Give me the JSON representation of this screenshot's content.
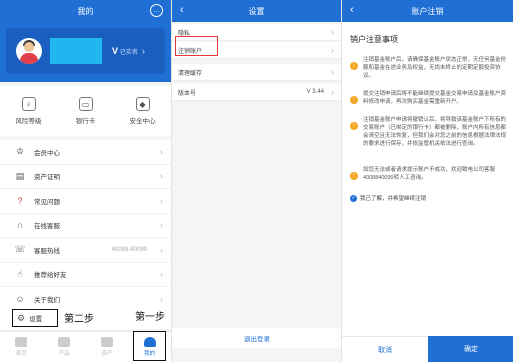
{
  "panel1": {
    "title": "我的",
    "verify_text": "已实名",
    "tools": [
      {
        "label": "风险等级",
        "icon": "risk-level-icon"
      },
      {
        "label": "银行卡",
        "icon": "bank-card-icon"
      },
      {
        "label": "安全中心",
        "icon": "security-center-icon"
      }
    ],
    "menu": [
      {
        "label": "会员中心",
        "icon": "crown-icon",
        "value": ""
      },
      {
        "label": "资产证明",
        "icon": "certificate-icon",
        "value": ""
      },
      {
        "label": "常见问题",
        "icon": "question-icon",
        "value": ""
      },
      {
        "label": "在线客服",
        "icon": "headset-icon",
        "value": ""
      },
      {
        "label": "客服热线",
        "icon": "phone-icon",
        "value": "40088-40099"
      },
      {
        "label": "推荐给好友",
        "icon": "thumbs-up-icon",
        "value": ""
      },
      {
        "label": "关于我们",
        "icon": "smile-icon",
        "value": ""
      }
    ],
    "settings_label": "设置",
    "step2": "第二步",
    "step1": "第一步",
    "tabs": [
      {
        "label": "首页"
      },
      {
        "label": "产品"
      },
      {
        "label": "资产"
      },
      {
        "label": "我的"
      }
    ]
  },
  "panel2": {
    "title": "设置",
    "rows": [
      {
        "label": "隐私",
        "value": ""
      },
      {
        "label": "注销账户",
        "value": ""
      },
      {
        "label": "清理缓存",
        "value": ""
      },
      {
        "label": "版本号",
        "value": "V 3.44"
      }
    ],
    "logout": "退出登录"
  },
  "panel3": {
    "title": "账户注销",
    "section_title": "销户注意事项",
    "notices": [
      "注销基金账户后，请确保基金账户状态正常，无任何基金份额和基金在途业务及权益，无尚未终止的定期定额投资协议。",
      "提交注销申请后将不能继续提交基金交易申请及基金账户资料修改申请，再次购买基金需重新开户。",
      "注销基金账户申请将撤销认后，将导致该基金账户下所有的交易账户（已绑定的银行卡）都被删除，账户内所有信息都会清空且无法恢复，但我们会对您之前的信息根据法律法规的要求进行保存，并依监管机关依法进行查询。",
      "如您无法或者请求提示账户不成功，欢迎致电公司客服4008840099转人工咨询。"
    ],
    "agree": "我已了解，并希望继续注销",
    "cancel": "取消",
    "confirm": "确定"
  }
}
